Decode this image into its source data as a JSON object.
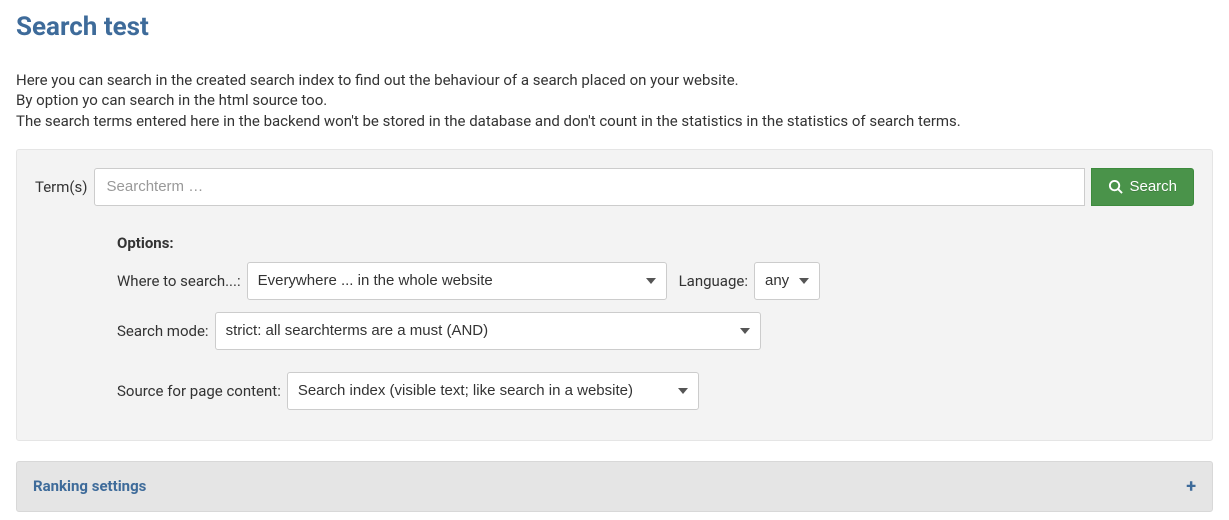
{
  "header": {
    "title": "Search test"
  },
  "intro": {
    "line1": "Here you can search in the created search index to find out the behaviour of a search placed on your website.",
    "line2": "By option yo can search in the html source too.",
    "line3": "The search terms entered here in the backend won't be stored in the database and don't count in the statistics in the statistics of search terms."
  },
  "search": {
    "terms_label": "Term(s)",
    "placeholder": "Searchterm …",
    "value": "",
    "button_label": "Search"
  },
  "options": {
    "heading": "Options:",
    "where_label": "Where to search...:",
    "where_value": "Everywhere ... in the whole website",
    "language_label": "Language:",
    "language_value": "any",
    "mode_label": "Search mode:",
    "mode_value": "strict: all searchterms are a must (AND)",
    "source_label": "Source for page content:",
    "source_value": "Search index (visible text; like search in a website)"
  },
  "accordion": {
    "title": "Ranking settings",
    "toggle": "+"
  }
}
